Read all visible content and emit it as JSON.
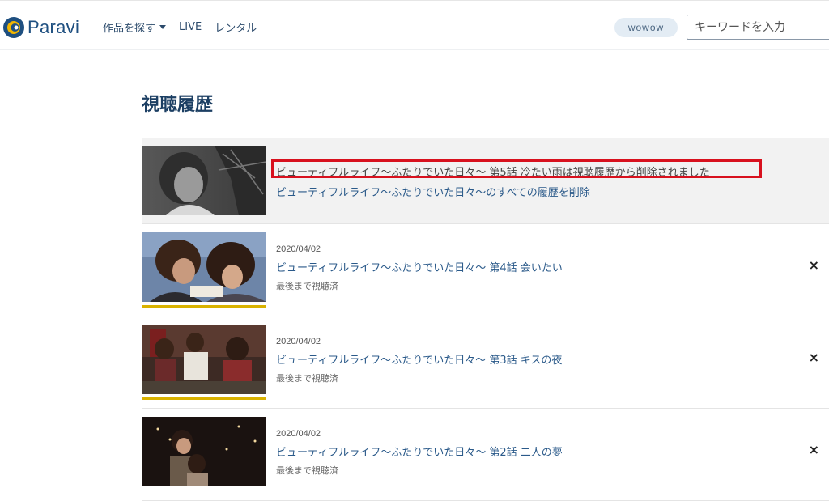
{
  "header": {
    "logo_text": "Paravi",
    "nav": {
      "browse": "作品を探す",
      "live": "LIVE",
      "rental": "レンタル"
    },
    "wowow": "wowow",
    "search_placeholder": "キーワードを入力"
  },
  "page_title": "視聴履歴",
  "deleted_row": {
    "message": "ビューティフルライフ〜ふたりでいた日々〜 第5話 冷たい雨は視聴履歴から削除されました",
    "delete_all": "ビューティフルライフ〜ふたりでいた日々〜のすべての履歴を削除"
  },
  "history": [
    {
      "date": "2020/04/02",
      "title": "ビューティフルライフ〜ふたりでいた日々〜 第4話 会いたい",
      "status": "最後まで視聴済",
      "close": "×"
    },
    {
      "date": "2020/04/02",
      "title": "ビューティフルライフ〜ふたりでいた日々〜 第3話 キスの夜",
      "status": "最後まで視聴済",
      "close": "×"
    },
    {
      "date": "2020/04/02",
      "title": "ビューティフルライフ〜ふたりでいた日々〜 第2話 二人の夢",
      "status": "最後まで視聴済",
      "close": "×"
    }
  ],
  "colors": {
    "brand": "#1e4f80",
    "link": "#2b5a8a",
    "progress": "#d9b200",
    "highlight": "#d8111e"
  }
}
